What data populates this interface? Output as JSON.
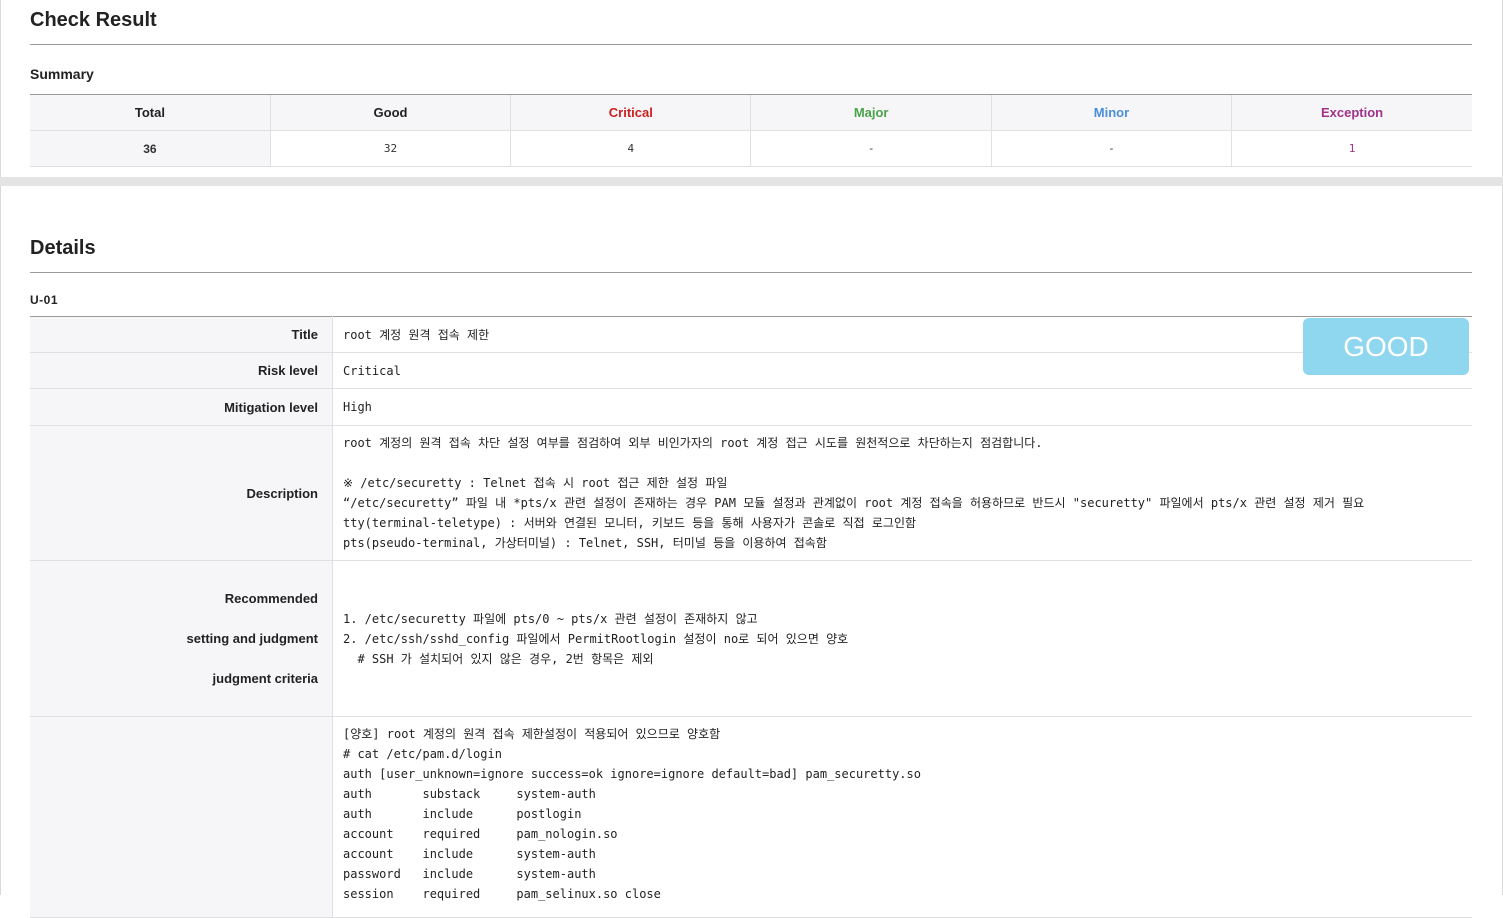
{
  "check_result": {
    "title": "Check Result",
    "summary_title": "Summary",
    "headers": [
      {
        "label": "Total",
        "color": "#222222"
      },
      {
        "label": "Good",
        "color": "#222222"
      },
      {
        "label": "Critical",
        "color": "#cc1f1f"
      },
      {
        "label": "Major",
        "color": "#4aa34a"
      },
      {
        "label": "Minor",
        "color": "#4a8fd8"
      },
      {
        "label": "Exception",
        "color": "#a0328a"
      }
    ],
    "values": [
      "36",
      "32",
      "4",
      "-",
      "-",
      "1"
    ]
  },
  "details": {
    "title": "Details",
    "item_id": "U-01",
    "status_badge": "GOOD",
    "rows": {
      "title_label": "Title",
      "title_value": "root 계정 원격 접속 제한",
      "risk_label": "Risk level",
      "risk_value": "Critical",
      "mitigation_label": "Mitigation level",
      "mitigation_value": "High",
      "description_label": "Description",
      "description_value": "root 계정의 원격 접속 차단 설정 여부를 점검하여 외부 비인가자의 root 계정 접근 시도를 원천적으로 차단하는지 점검합니다.\n\n※ /etc/securetty : Telnet 접속 시 root 접근 제한 설정 파일\n“/etc/securetty” 파일 내 *pts/x 관련 설정이 존재하는 경우 PAM 모듈 설정과 관계없이 root 계정 접속을 허용하므로 반드시 \"securetty\" 파일에서 pts/x 관련 설정 제거 필요\ntty(terminal-teletype) : 서버와 연결된 모니터, 키보드 등을 통해 사용자가 콘솔로 직접 로그인함\npts(pseudo-terminal, 가상터미널) : Telnet, SSH, 터미널 등을 이용하여 접속함",
      "recommended_label_lines": [
        "Recommended",
        "setting and judgment",
        "judgment criteria"
      ],
      "recommended_value": "1. /etc/securetty 파일에 pts/0 ~ pts/x 관련 설정이 존재하지 않고\n2. /etc/ssh/sshd_config 파일에서 PermitRootlogin 설정이 no로 되어 있으면 양호\n  # SSH 가 설치되어 있지 않은 경우, 2번 항목은 제외",
      "result_label": "",
      "result_value": "[양호] root 계정의 원격 접속 제한설정이 적용되어 있으므로 양호함\n# cat /etc/pam.d/login\nauth [user_unknown=ignore success=ok ignore=ignore default=bad] pam_securetty.so\nauth       substack     system-auth\nauth       include      postlogin\naccount    required     pam_nologin.so\naccount    include      system-auth\npassword   include      system-auth\nsession    required     pam_selinux.so close"
    }
  }
}
